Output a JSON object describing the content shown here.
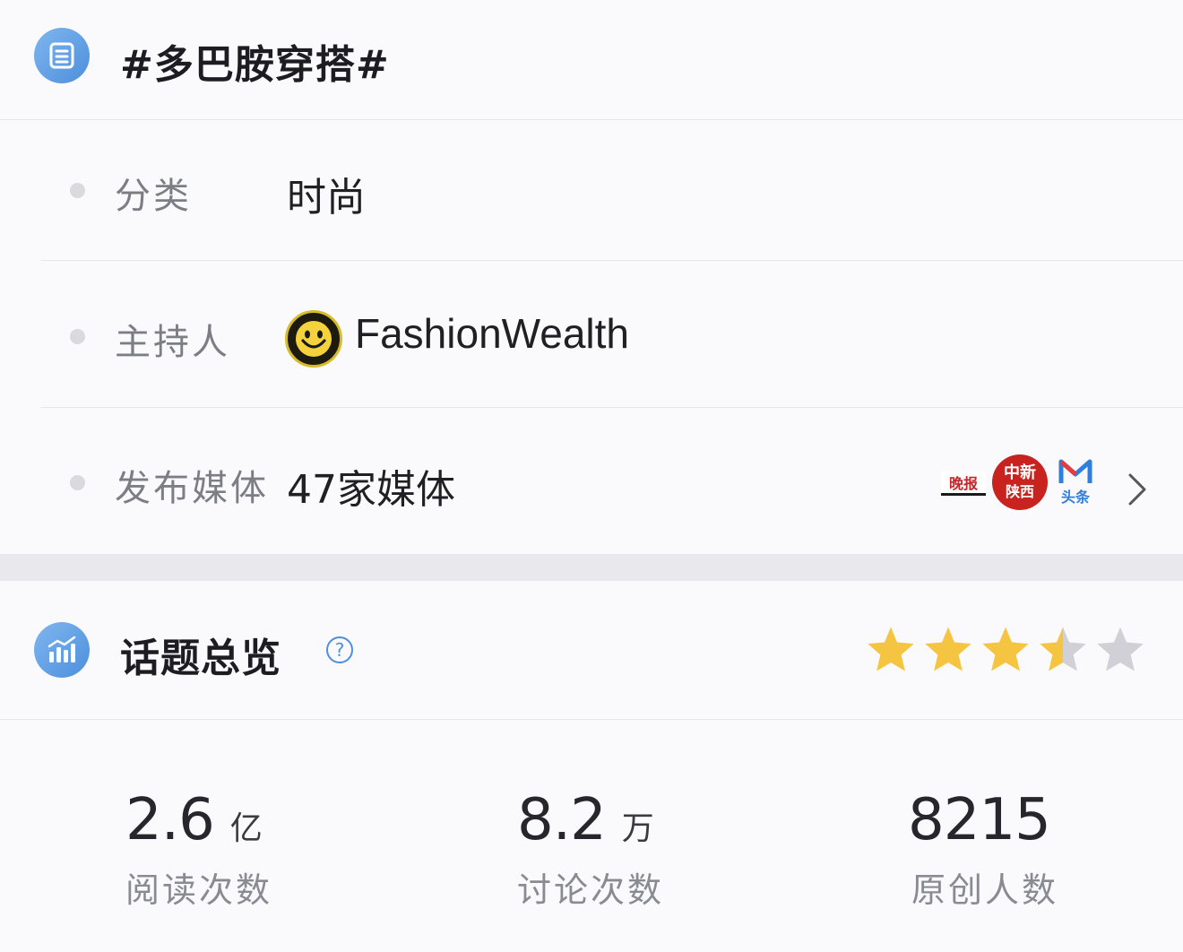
{
  "topic": {
    "title": "#多巴胺穿搭#",
    "icon": "list-icon"
  },
  "info_rows": [
    {
      "label": "分类",
      "value": "时尚"
    },
    {
      "label": "主持人",
      "value": "FashionWealth",
      "avatar": "smiley-avatar"
    },
    {
      "label": "发布媒体",
      "value": "47家媒体"
    }
  ],
  "media_logos": [
    {
      "name": "media-logo-1",
      "text": "晚报"
    },
    {
      "name": "media-logo-2",
      "text_top": "中新",
      "text_bottom": "陕西"
    },
    {
      "name": "media-logo-3",
      "text": "头条"
    }
  ],
  "overview": {
    "title": "话题总览",
    "help_symbol": "?",
    "rating": 3.5,
    "rating_max": 5
  },
  "stats": [
    {
      "value": "2.6",
      "unit": "亿",
      "label": "阅读次数"
    },
    {
      "value": "8.2",
      "unit": "万",
      "label": "讨论次数"
    },
    {
      "value": "8215",
      "unit": "",
      "label": "原创人数"
    }
  ],
  "colors": {
    "accent_blue": "#4d8fdc",
    "star_gold": "#f5c542",
    "star_gray": "#d0d0d6"
  }
}
